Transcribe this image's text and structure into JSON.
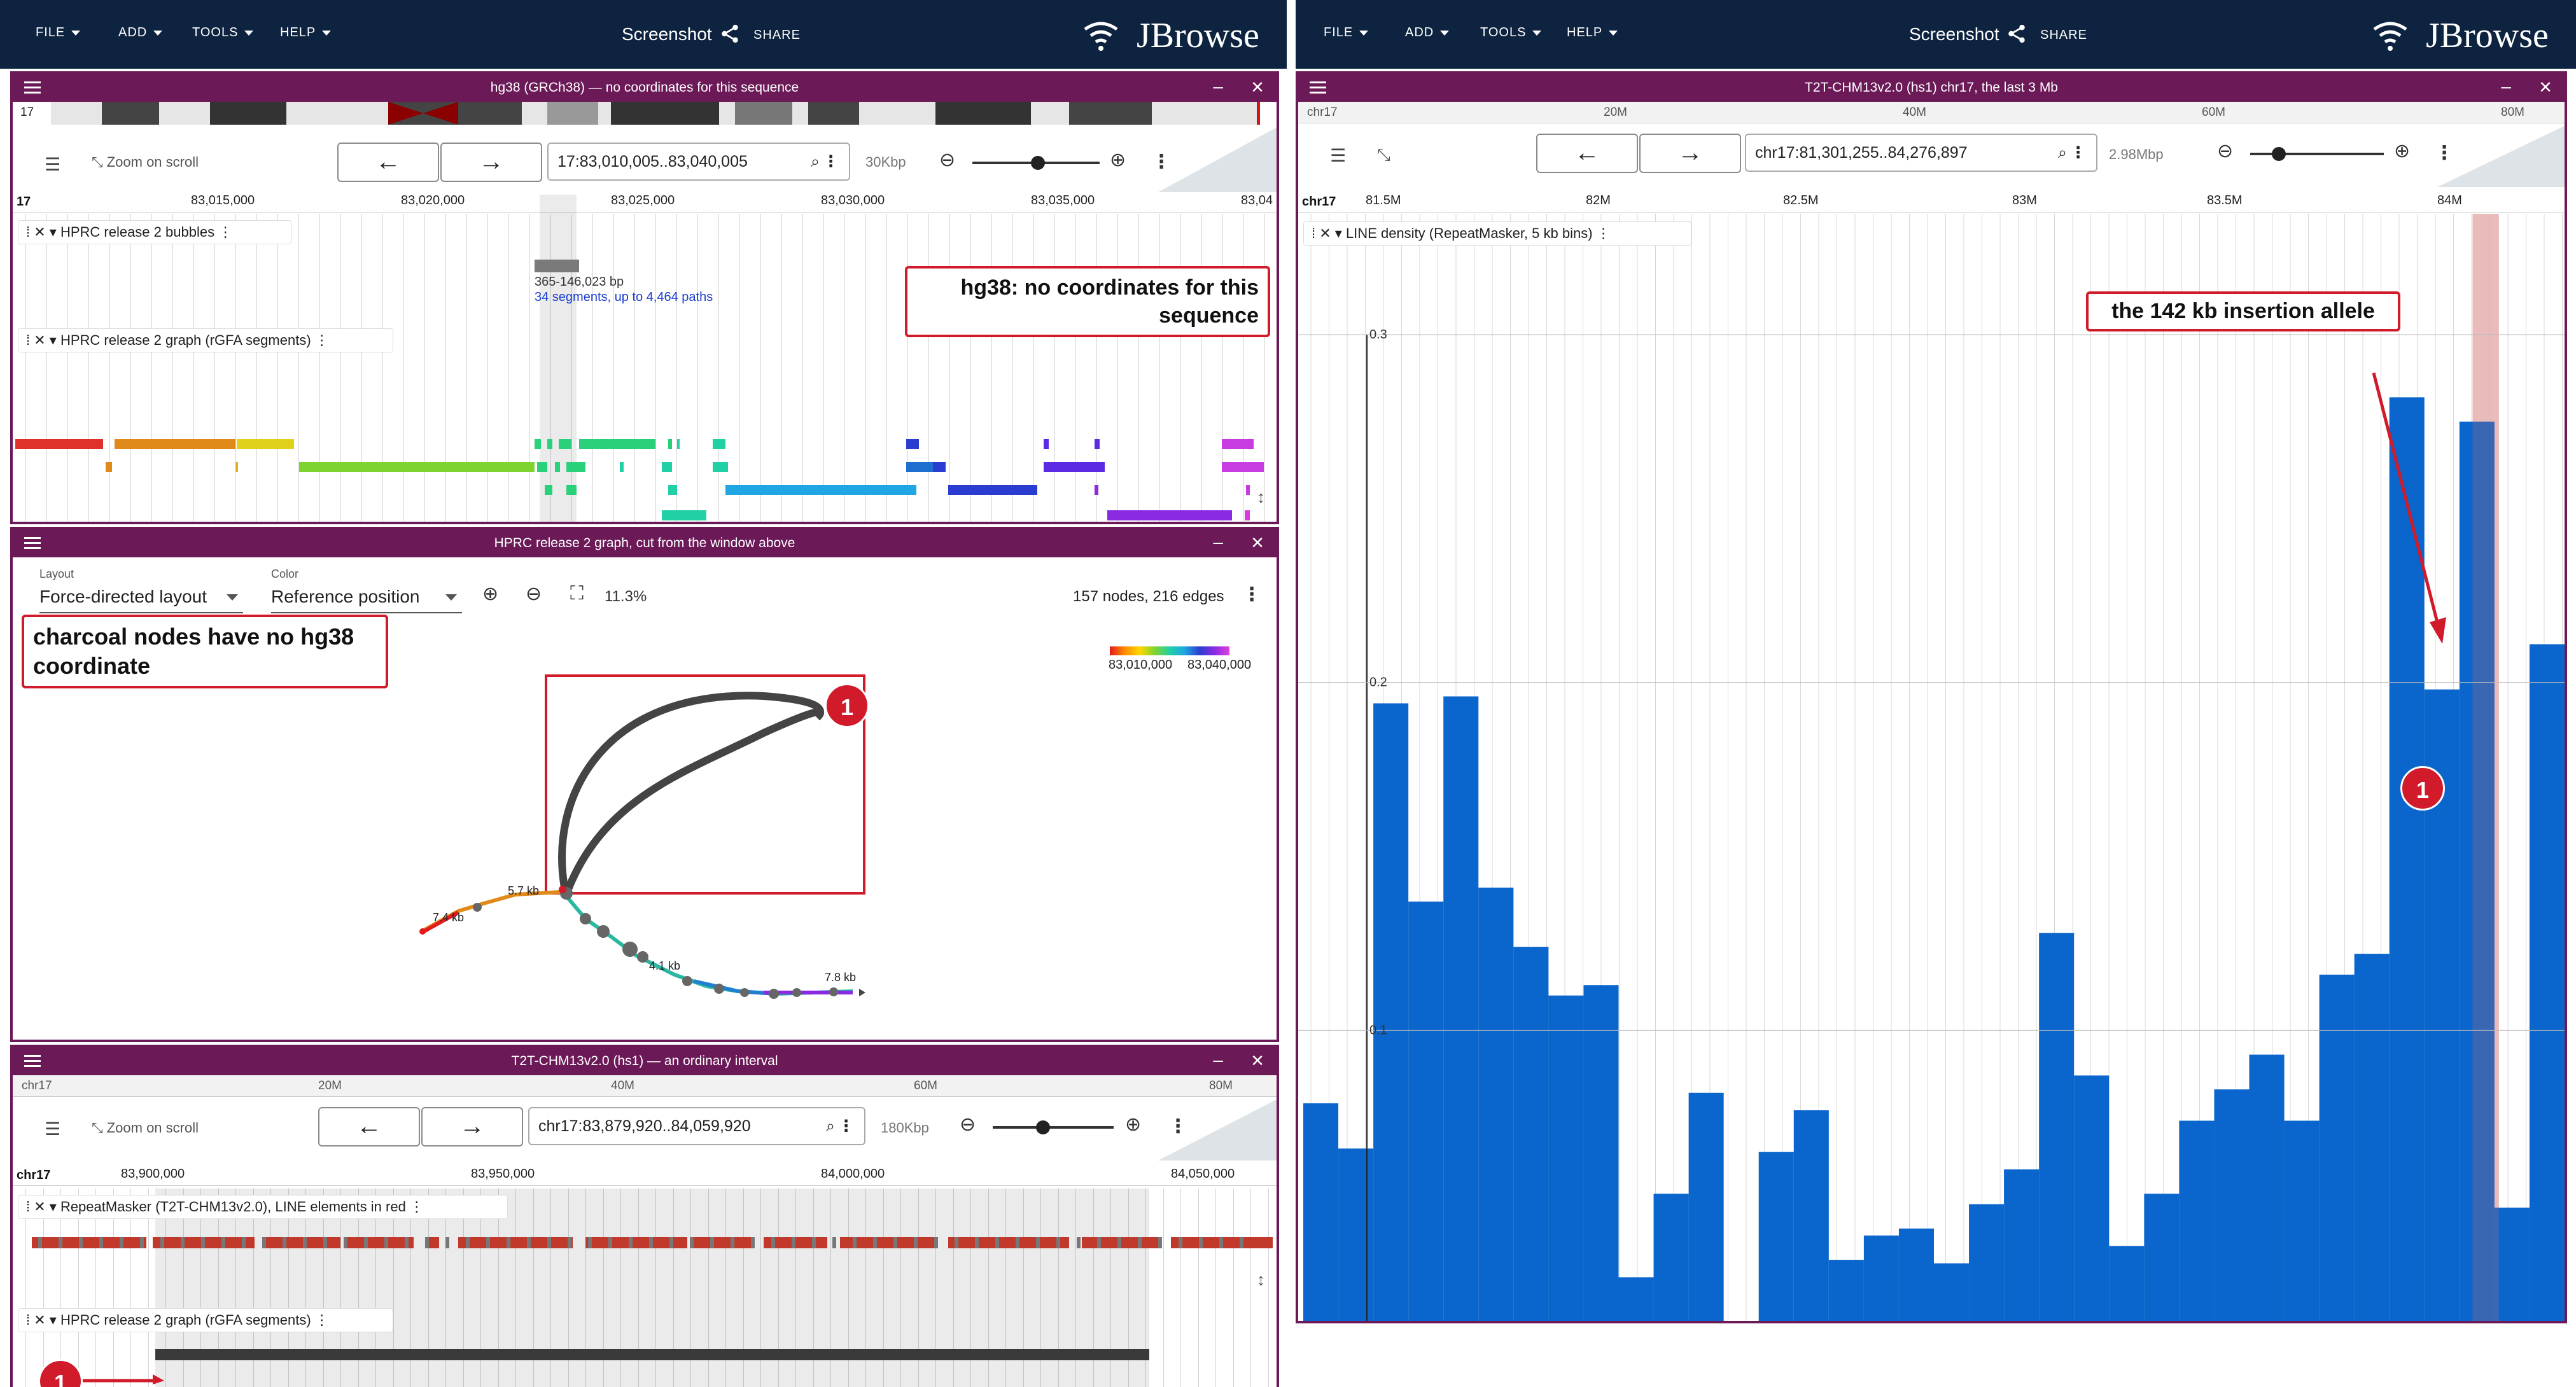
{
  "left_app": {
    "menu": {
      "file": "FILE",
      "add": "ADD",
      "tools": "TOOLS",
      "help": "HELP"
    },
    "screenshot_title": "Screenshot",
    "share_label": "SHARE",
    "brand": "JBrowse",
    "view1": {
      "title": "hg38 (GRCh38) — no coordinates for this sequence",
      "overview_chr": "17",
      "zoom_on_scroll": "Zoom on scroll",
      "location": "17:83,010,005..83,040,005",
      "span": "30Kbp",
      "chr": "17",
      "ticks": [
        "83,015,000",
        "83,020,000",
        "83,025,000",
        "83,030,000",
        "83,035,000",
        "83,04"
      ],
      "tracks": [
        {
          "name": "HPRC release 2 bubbles"
        },
        {
          "name": "HPRC release 2 graph (rGFA segments)"
        }
      ],
      "bubble_label_1": "365-146,023 bp",
      "bubble_label_2": "34 segments, up to 4,464 paths",
      "annotation": "hg38: no coordinates for this sequence",
      "scroll_icon": "↕"
    },
    "view2": {
      "title": "HPRC release 2 graph, cut from the window above",
      "layout_label": "Layout",
      "layout_value": "Force-directed layout",
      "color_label": "Color",
      "color_value": "Reference position",
      "zoom_pct": "11.3%",
      "counts": "157 nodes, 216 edges",
      "legend_min": "83,010,000",
      "legend_max": "83,040,000",
      "annotation": "charcoal nodes have no hg38 coordinate",
      "badge": "1",
      "node_labels": [
        "7.4 kb",
        "5.7 kb",
        "4.1 kb",
        "7.8 kb"
      ]
    },
    "view3": {
      "title": "T2T-CHM13v2.0 (hs1) — an ordinary interval",
      "overview_chr": "chr17",
      "overview_ticks": [
        "20M",
        "40M",
        "60M",
        "80M"
      ],
      "zoom_on_scroll": "Zoom on scroll",
      "location": "chr17:83,879,920..84,059,920",
      "span": "180Kbp",
      "chr": "chr17",
      "ticks": [
        "83,900,000",
        "83,950,000",
        "84,000,000",
        "84,050,000"
      ],
      "tracks": [
        {
          "name": "RepeatMasker (T2T-CHM13v2.0), LINE elements in red"
        },
        {
          "name": "HPRC release 2 graph (rGFA segments)"
        }
      ],
      "badge": "1",
      "scroll_icon": "↕"
    }
  },
  "right_app": {
    "menu": {
      "file": "FILE",
      "add": "ADD",
      "tools": "TOOLS",
      "help": "HELP"
    },
    "screenshot_title": "Screenshot",
    "share_label": "SHARE",
    "brand": "JBrowse",
    "view": {
      "title": "T2T-CHM13v2.0 (hs1) chr17, the last 3 Mb",
      "overview_chr": "chr17",
      "overview_ticks": [
        "20M",
        "40M",
        "60M",
        "80M"
      ],
      "location": "chr17:81,301,255..84,276,897",
      "span": "2.98Mbp",
      "chr": "chr17",
      "ticks": [
        "81.5M",
        "82M",
        "82.5M",
        "83M",
        "83.5M",
        "84M"
      ],
      "track": "LINE density (RepeatMasker, 5 kb bins)",
      "annotation": "the 142 kb insertion allele",
      "badge": "1"
    }
  },
  "colors": {
    "appbar": "#0d233f",
    "view_header": "#6b1a57",
    "bar": "#0a66cc",
    "annotation": "#d11a2a",
    "highlight": "#f2c4c4"
  },
  "chart_data": {
    "type": "bar",
    "title": "LINE density (RepeatMasker, 5 kb bins)",
    "xlabel": "",
    "ylabel": "",
    "x_unit": "Mb on chr17",
    "ylim": [
      0,
      0.3
    ],
    "yticks": [
      "0.3",
      "0.2",
      "0.1",
      "0"
    ],
    "x": [
      81.3,
      81.38,
      81.46,
      81.54,
      81.62,
      81.7,
      81.78,
      81.86,
      81.94,
      82.02,
      82.1,
      82.18,
      82.26,
      82.34,
      82.42,
      82.5,
      82.58,
      82.66,
      82.74,
      82.82,
      82.9,
      82.98,
      83.06,
      83.14,
      83.22,
      83.3,
      83.38,
      83.46,
      83.54,
      83.62,
      83.7,
      83.78,
      83.86,
      83.94,
      84.02,
      84.1,
      84.18
    ],
    "values": [
      0.079,
      0.066,
      0.194,
      0.137,
      0.196,
      0.141,
      0.124,
      0.11,
      0.113,
      0.029,
      0.053,
      0.082,
      0.008,
      0.065,
      0.077,
      0.034,
      0.041,
      0.043,
      0.033,
      0.05,
      0.06,
      0.128,
      0.087,
      0.038,
      0.053,
      0.074,
      0.083,
      0.093,
      0.074,
      0.116,
      0.122,
      0.282,
      0.198,
      0.275,
      0.049,
      0.211
    ],
    "highlight_x_range": [
      83.97,
      84.03
    ]
  }
}
